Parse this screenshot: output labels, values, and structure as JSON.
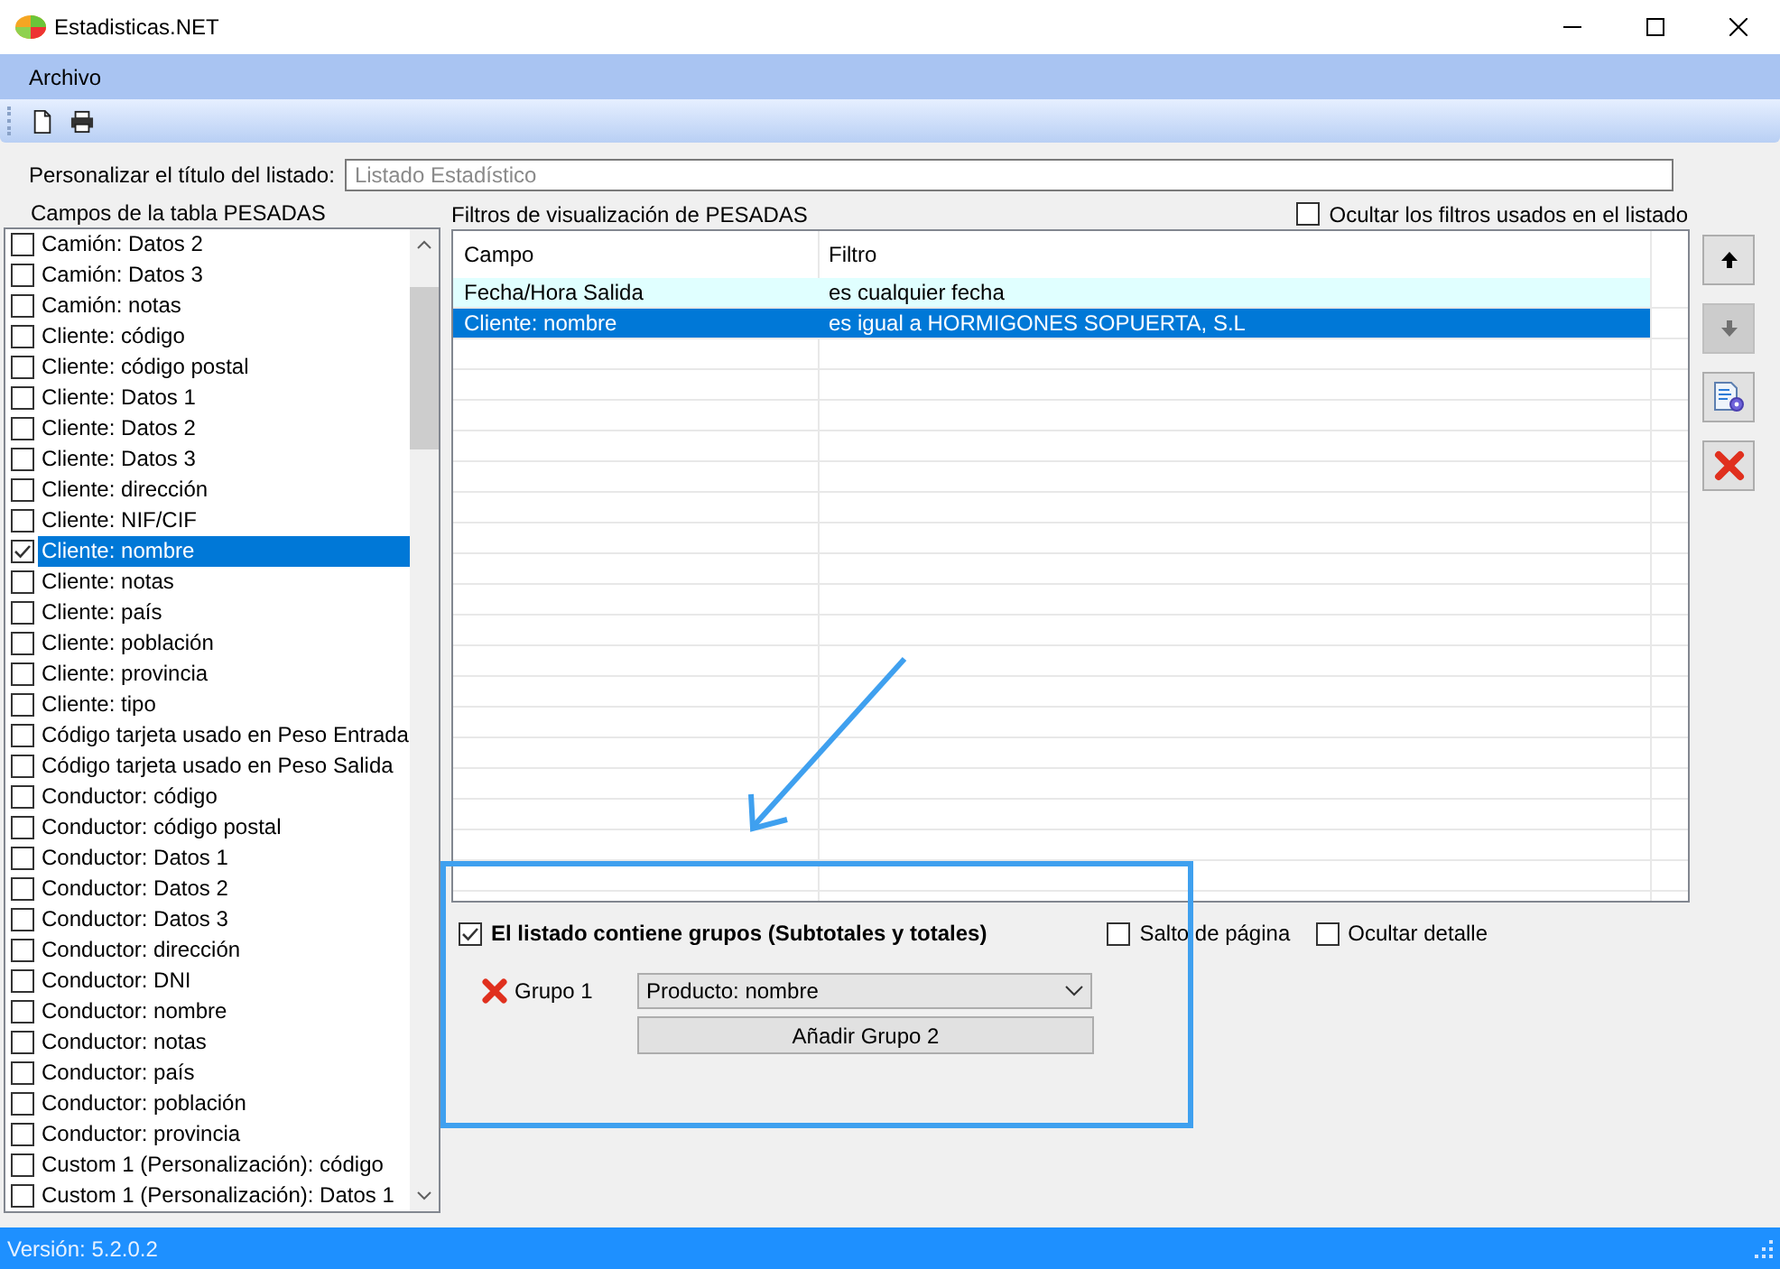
{
  "window": {
    "title": "Estadisticas.NET"
  },
  "menu": [
    {
      "label": "Archivo"
    }
  ],
  "title_field": {
    "label": "Personalizar el título del listado:",
    "placeholder": "Listado Estadístico"
  },
  "fields_panel": {
    "label": "Campos de la tabla PESADAS",
    "items": [
      {
        "label": "Camión: Datos 2",
        "checked": false,
        "selected": false
      },
      {
        "label": "Camión: Datos 3",
        "checked": false,
        "selected": false
      },
      {
        "label": "Camión: notas",
        "checked": false,
        "selected": false
      },
      {
        "label": "Cliente: código",
        "checked": false,
        "selected": false
      },
      {
        "label": "Cliente: código postal",
        "checked": false,
        "selected": false
      },
      {
        "label": "Cliente: Datos 1",
        "checked": false,
        "selected": false
      },
      {
        "label": "Cliente: Datos 2",
        "checked": false,
        "selected": false
      },
      {
        "label": "Cliente: Datos 3",
        "checked": false,
        "selected": false
      },
      {
        "label": "Cliente: dirección",
        "checked": false,
        "selected": false
      },
      {
        "label": "Cliente: NIF/CIF",
        "checked": false,
        "selected": false
      },
      {
        "label": "Cliente: nombre",
        "checked": true,
        "selected": true
      },
      {
        "label": "Cliente: notas",
        "checked": false,
        "selected": false
      },
      {
        "label": "Cliente: país",
        "checked": false,
        "selected": false
      },
      {
        "label": "Cliente: población",
        "checked": false,
        "selected": false
      },
      {
        "label": "Cliente: provincia",
        "checked": false,
        "selected": false
      },
      {
        "label": "Cliente: tipo",
        "checked": false,
        "selected": false
      },
      {
        "label": "Código tarjeta usado en Peso Entrada",
        "checked": false,
        "selected": false
      },
      {
        "label": "Código tarjeta usado en Peso Salida",
        "checked": false,
        "selected": false
      },
      {
        "label": "Conductor: código",
        "checked": false,
        "selected": false
      },
      {
        "label": "Conductor: código postal",
        "checked": false,
        "selected": false
      },
      {
        "label": "Conductor: Datos 1",
        "checked": false,
        "selected": false
      },
      {
        "label": "Conductor: Datos 2",
        "checked": false,
        "selected": false
      },
      {
        "label": "Conductor: Datos 3",
        "checked": false,
        "selected": false
      },
      {
        "label": "Conductor: dirección",
        "checked": false,
        "selected": false
      },
      {
        "label": "Conductor: DNI",
        "checked": false,
        "selected": false
      },
      {
        "label": "Conductor: nombre",
        "checked": false,
        "selected": false
      },
      {
        "label": "Conductor: notas",
        "checked": false,
        "selected": false
      },
      {
        "label": "Conductor: país",
        "checked": false,
        "selected": false
      },
      {
        "label": "Conductor: población",
        "checked": false,
        "selected": false
      },
      {
        "label": "Conductor: provincia",
        "checked": false,
        "selected": false
      },
      {
        "label": "Custom 1 (Personalización): código",
        "checked": false,
        "selected": false
      },
      {
        "label": "Custom 1 (Personalización): Datos 1",
        "checked": false,
        "selected": false
      }
    ]
  },
  "filters": {
    "label": "Filtros de visualización de PESADAS",
    "hide_option": {
      "label": "Ocultar los filtros usados en el listado",
      "checked": false
    },
    "columns": [
      "Campo",
      "Filtro"
    ],
    "rows": [
      {
        "campo": "Fecha/Hora Salida",
        "filtro": "es cualquier fecha",
        "hovered": true,
        "selected": false
      },
      {
        "campo": "Cliente: nombre",
        "filtro": "es igual a HORMIGONES SOPUERTA, S.L",
        "hovered": false,
        "selected": true
      }
    ]
  },
  "side_buttons": [
    {
      "kind": "up",
      "disabled": false
    },
    {
      "kind": "down",
      "disabled": true
    },
    {
      "kind": "edit",
      "disabled": false
    },
    {
      "kind": "delete",
      "disabled": false
    }
  ],
  "grouping": {
    "groups_option": {
      "label": "El listado contiene grupos (Subtotales y totales)",
      "checked": true
    },
    "page_break": {
      "label": "Salto de página",
      "checked": false
    },
    "hide_detail": {
      "label": "Ocultar detalle",
      "checked": false
    },
    "groups": [
      {
        "label": "Grupo 1",
        "value": "Producto: nombre"
      }
    ],
    "add_button": "Añadir Grupo 2"
  },
  "status_bar": {
    "version": "Versión: 5.2.0.2"
  }
}
